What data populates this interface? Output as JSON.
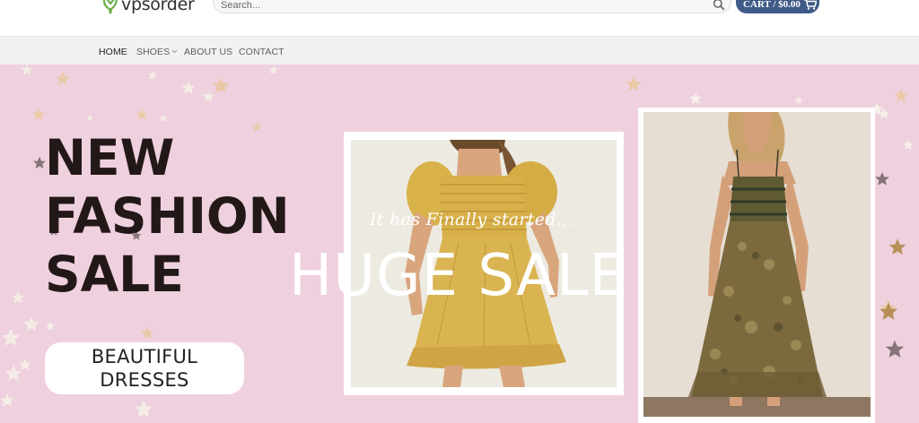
{
  "brand": {
    "name": "vpsorder",
    "accent": "#3f5a86",
    "logo_color": "#6ab04c"
  },
  "search": {
    "placeholder": "Search...",
    "icon": "search-icon"
  },
  "cart": {
    "label": "CART / $0.00",
    "icon": "cart-icon"
  },
  "nav": {
    "items": [
      {
        "label": "HOME",
        "active": true
      },
      {
        "label": "SHOES",
        "has_dropdown": true
      },
      {
        "label": "ABOUT US"
      },
      {
        "label": "CONTACT"
      }
    ]
  },
  "hero": {
    "background": "#efd0de",
    "headline": [
      "NEW",
      "FASHION",
      "SALE"
    ],
    "pill": [
      "BEAUTIFUL",
      "DRESSES"
    ],
    "script": "It has Finally started...",
    "sale": "HUGE SALE"
  }
}
